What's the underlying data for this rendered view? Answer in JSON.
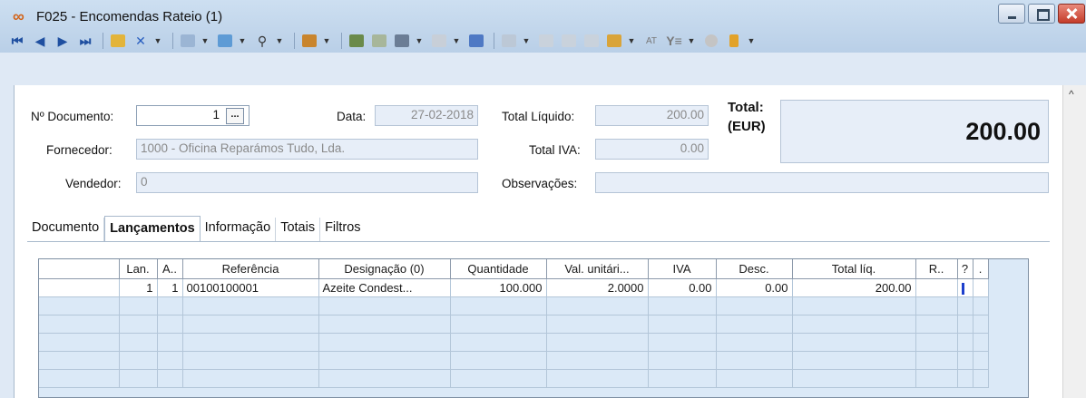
{
  "window": {
    "title": "F025 - Encomendas Rateio (1)",
    "app_icon": "infinity-icon"
  },
  "toolbar": {
    "icons": [
      "first-icon",
      "prev-icon",
      "next-icon",
      "last-icon",
      "edit-icon",
      "delete-icon",
      "properties-icon",
      "export-icon",
      "search-icon",
      "tools-icon",
      "post-icon",
      "unpost-icon",
      "print-icon",
      "email-icon",
      "validate-icon",
      "docs-icon",
      "grid-icon",
      "list-icon",
      "report-icon",
      "wizard-icon",
      "at-icon",
      "filter-icon",
      "globe-icon",
      "exit-icon"
    ],
    "at_label": "AT"
  },
  "header": {
    "doc_number_label": "Nº Documento:",
    "doc_number_value": "1",
    "doc_number_button": "...",
    "date_label": "Data:",
    "date_value": "27-02-2018",
    "supplier_label": "Fornecedor:",
    "supplier_value": "1000 - Oficina Reparámos Tudo, Lda.",
    "seller_label": "Vendedor:",
    "seller_value": "0",
    "total_liquid_label": "Total Líquido:",
    "total_liquid_value": "200.00",
    "total_vat_label": "Total IVA:",
    "total_vat_value": "0.00",
    "notes_label": "Observações:",
    "notes_value": "",
    "total_label": "Total:",
    "total_currency": "(EUR)",
    "total_value": "200.00"
  },
  "tabs": [
    "Documento",
    "Lançamentos",
    "Informação",
    "Totais",
    "Filtros"
  ],
  "active_tab": "Lançamentos",
  "grid": {
    "columns": [
      "",
      "Lan.",
      "A..",
      "Referência",
      "Designação (0)",
      "Quantidade",
      "Val. unitári...",
      "IVA",
      "Desc.",
      "Total líq.",
      "R..",
      "?",
      "."
    ],
    "rows": [
      [
        "",
        "1",
        "1",
        "00100100001",
        "Azeite Condest...",
        "100.000",
        "2.0000",
        "0.00",
        "0.00",
        "200.00",
        "",
        "",
        ""
      ]
    ]
  },
  "colors": {
    "accent": "#1d3fcc",
    "field_bg": "#e7eef8",
    "grid_bg": "#dbe9f7"
  }
}
